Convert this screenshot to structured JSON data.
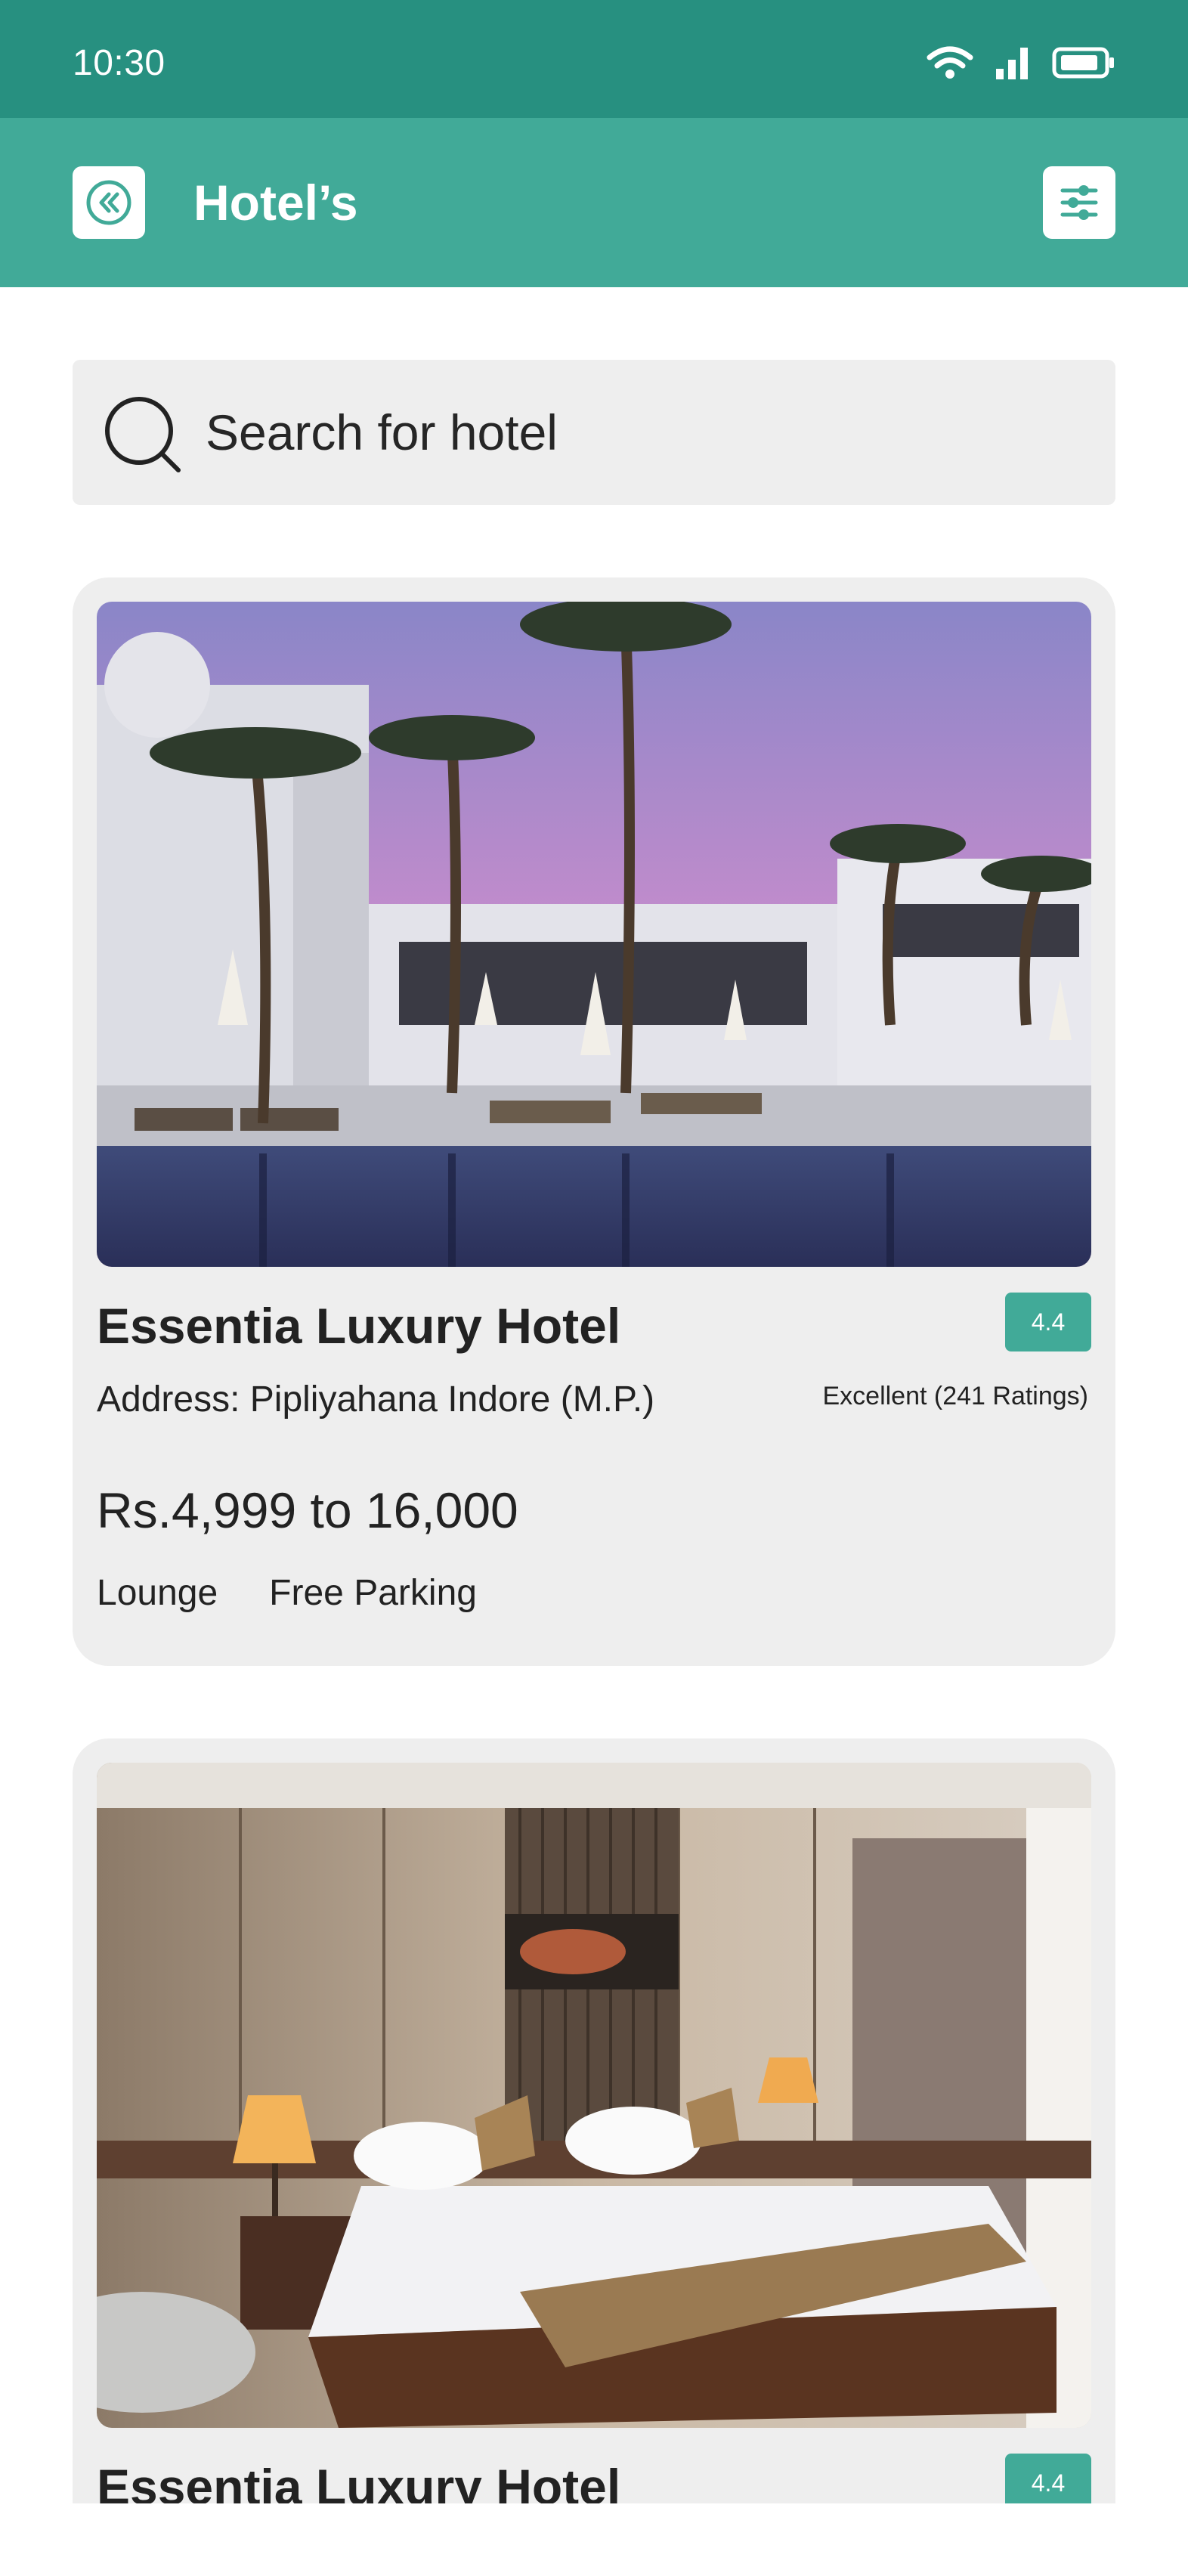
{
  "status_bar": {
    "time": "10:30"
  },
  "app_bar": {
    "title": "Hotel’s"
  },
  "search": {
    "placeholder": "Search for hotel"
  },
  "hotels": [
    {
      "name": "Essentia Luxury Hotel",
      "rating": "4.4",
      "address": "Address: Pipliyahana Indore (M.P.)",
      "rating_text": "Excellent (241 Ratings)",
      "price": "Rs.4,999 to 16,000",
      "amenities": [
        "Lounge",
        "Free Parking"
      ],
      "image": "resort-pool-palm-trees-sunset"
    },
    {
      "name": "Essentia Luxury Hotel",
      "rating": "4.4",
      "image": "hotel-bedroom-with-lamps"
    }
  ],
  "colors": {
    "status_bar": "#279080",
    "app_bar": "#41aa98",
    "accent": "#41aa98",
    "card_bg": "#eeeeee"
  }
}
